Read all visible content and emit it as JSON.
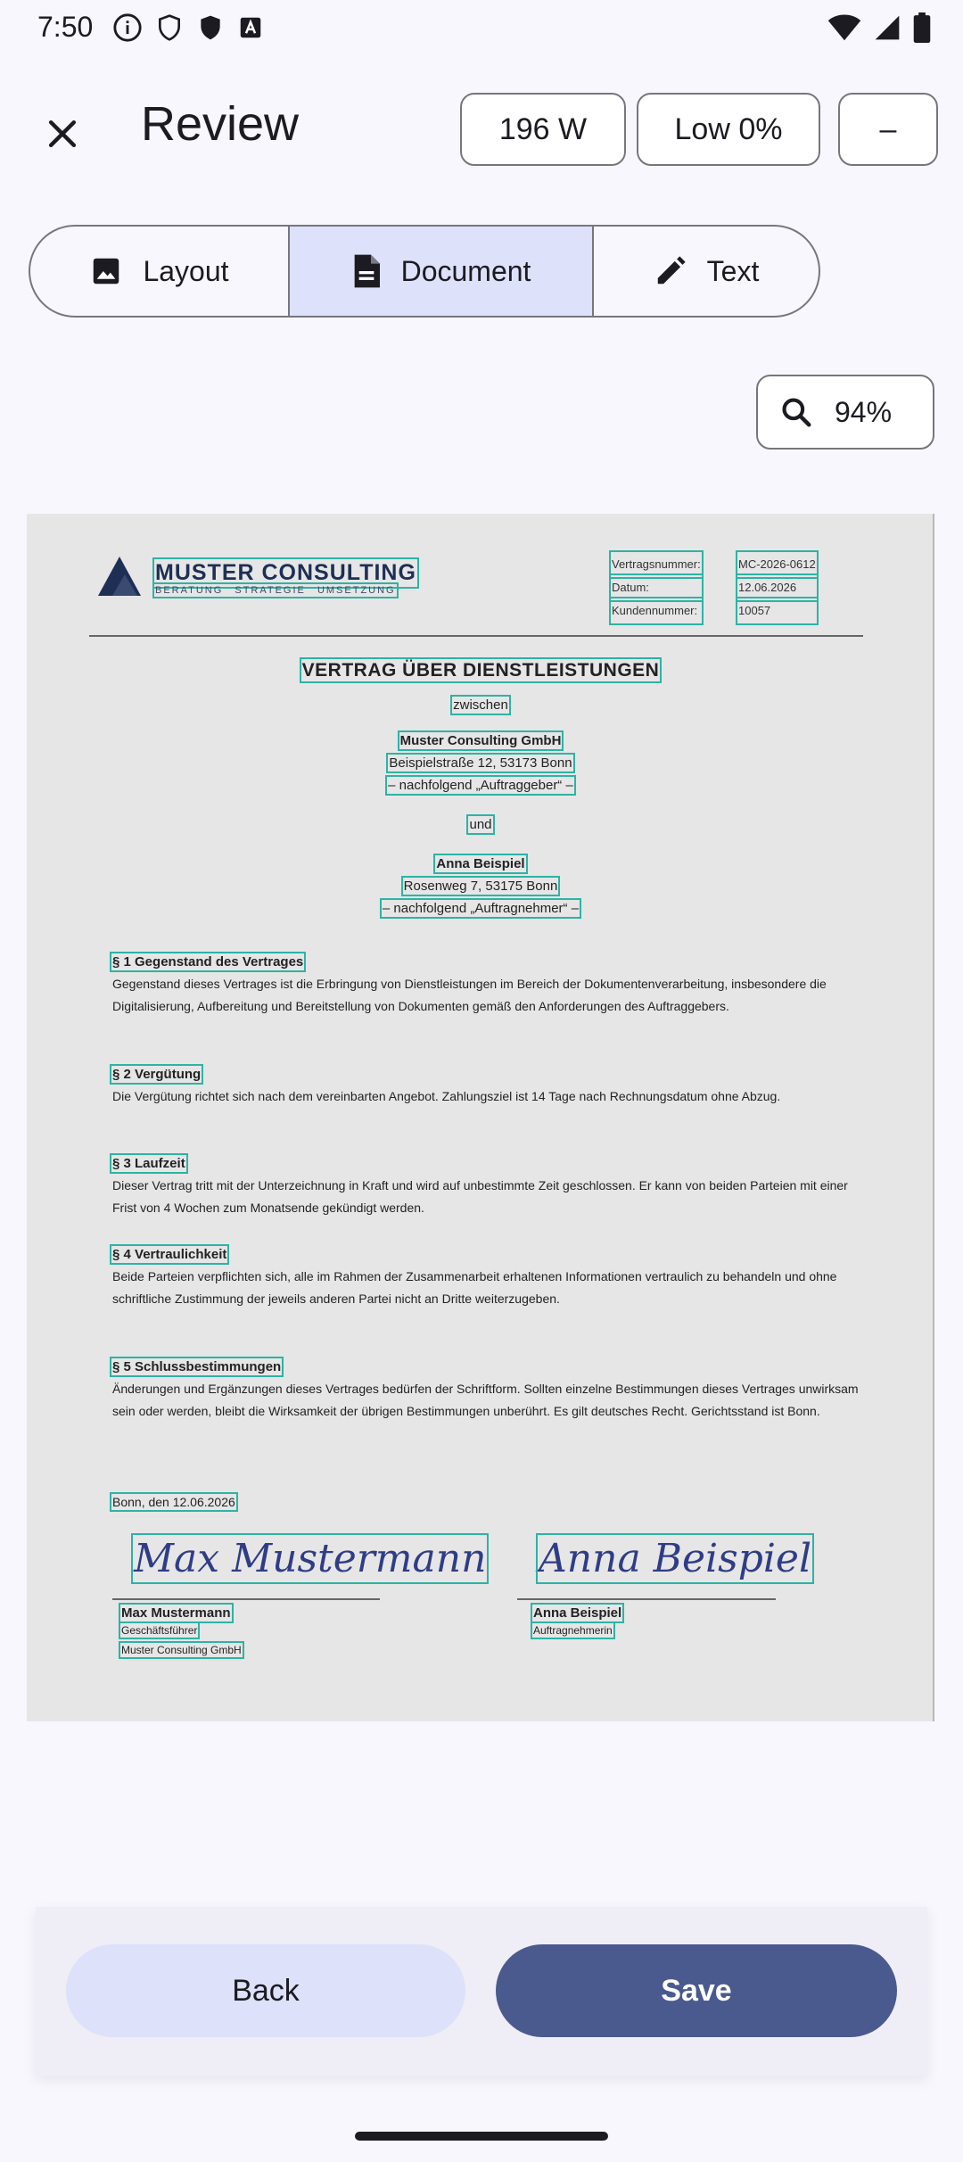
{
  "status": {
    "time": "7:50"
  },
  "header": {
    "title": "Review",
    "chip_watts": "196 W",
    "chip_low": "Low 0%",
    "chip_minus": "–"
  },
  "segments": [
    {
      "label": "Layout",
      "icon": "image-icon",
      "selected": false
    },
    {
      "label": "Document",
      "icon": "document-icon",
      "selected": true
    },
    {
      "label": "Text",
      "icon": "pencil-icon",
      "selected": false
    }
  ],
  "zoom": {
    "value": "94%"
  },
  "document": {
    "brand": "MUSTER CONSULTING",
    "brand_tagline": "BERATUNG STRATEGIE UMSETZUNG",
    "meta_labels": [
      "Vertragsnummer:",
      "Datum:",
      "Kundennummer:"
    ],
    "meta_values": [
      "MC-2026-0612",
      "12.06.2026",
      "10057"
    ],
    "title": "VERTRAG ÜBER DIENSTLEISTUNGEN",
    "between": "zwischen",
    "party1_name": "Muster Consulting GmbH",
    "party1_address": "Beispielstraße 12, 53173 Bonn",
    "party1_role": "– nachfolgend „Auftraggeber“ –",
    "and": "und",
    "party2_name": "Anna Beispiel",
    "party2_address": "Rosenweg 7, 53175 Bonn",
    "party2_role": "– nachfolgend „Auftragnehmer“ –",
    "sections": [
      {
        "heading": "§ 1 Gegenstand des Vertrages",
        "text": "Gegenstand dieses Vertrages ist die Erbringung von Dienstleistungen im Bereich der Dokumentenverarbeitung, insbesondere die Digitalisierung, Aufbereitung und Bereitstellung von Dokumenten gemäß den Anforderungen des Auftraggebers."
      },
      {
        "heading": "§ 2 Vergütung",
        "text": "Die Vergütung richtet sich nach dem vereinbarten Angebot. Zahlungsziel ist 14 Tage nach Rechnungsdatum ohne Abzug."
      },
      {
        "heading": "§ 3 Laufzeit",
        "text": "Dieser Vertrag tritt mit der Unterzeichnung in Kraft und wird auf unbestimmte Zeit geschlossen. Er kann von beiden Parteien mit einer Frist von 4 Wochen zum Monatsende gekündigt werden."
      },
      {
        "heading": "§ 4 Vertraulichkeit",
        "text": "Beide Parteien verpflichten sich, alle im Rahmen der Zusammenarbeit erhaltenen Informationen vertraulich zu behandeln und ohne schriftliche Zustimmung der jeweils anderen Partei nicht an Dritte weiterzugeben."
      },
      {
        "heading": "§ 5 Schlussbestimmungen",
        "text": "Änderungen und Ergänzungen dieses Vertrages bedürfen der Schriftform. Sollten einzelne Bestimmungen dieses Vertrages unwirksam sein oder werden, bleibt die Wirksamkeit der übrigen Bestimmungen unberührt. Es gilt deutsches Recht. Gerichtsstand ist Bonn."
      }
    ],
    "place_date": "Bonn, den 12.06.2026",
    "signature1": "Max Mustermann",
    "signer1_name": "Max Mustermann",
    "signer1_role": "Geschäftsführer",
    "signer1_company": "Muster Consulting GmbH",
    "signature2": "Anna Beispiel",
    "signer2_name": "Anna Beispiel",
    "signer2_role": "Auftragnehmerin"
  },
  "footer": {
    "back_label": "Back",
    "save_label": "Save"
  },
  "colors": {
    "accent": "#4a5a8e",
    "selected_segment": "#dde1f9",
    "ocr_box": "#2eb3a4"
  }
}
